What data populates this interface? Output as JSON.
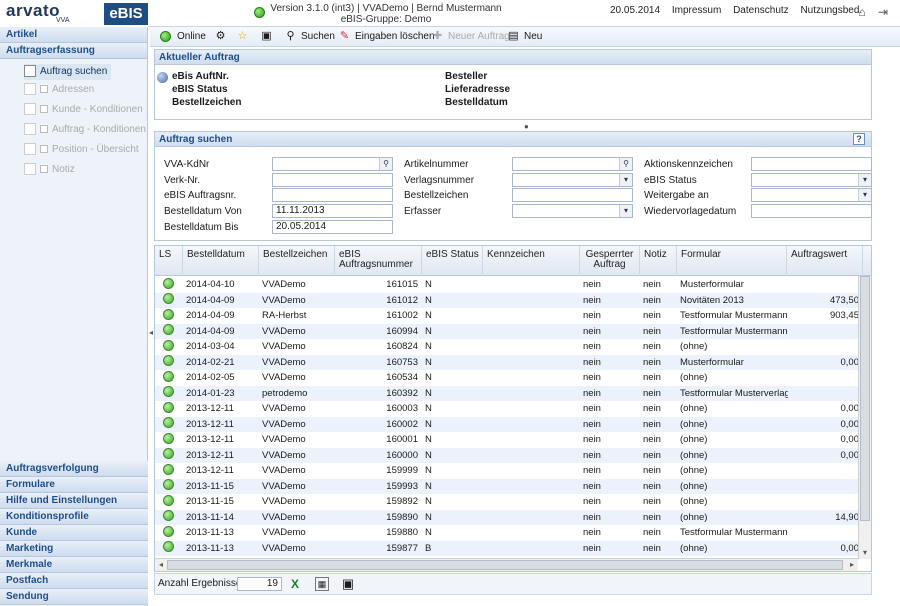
{
  "brand": {
    "logo": "arvato",
    "logo_sub": "VVA",
    "product": "eBIS"
  },
  "header": {
    "line1": "Version 3.1.0 (int3) | VVADemo | Bernd Mustermann",
    "line2": "eBIS-Gruppe: Demo",
    "date": "20.05.2014",
    "links": [
      "Impressum",
      "Datenschutz",
      "Nutzungsbed."
    ]
  },
  "sidebar": {
    "top_sections": [
      "Artikel",
      "Auftragserfassung"
    ],
    "items": [
      {
        "label": "Auftrag suchen",
        "active": true
      },
      {
        "label": "Adressen",
        "active": false
      },
      {
        "label": "Kunde - Konditionen",
        "active": false
      },
      {
        "label": "Auftrag - Konditionen",
        "active": false
      },
      {
        "label": "Position - Übersicht",
        "active": false
      },
      {
        "label": "Notiz",
        "active": false
      }
    ],
    "bottom_sections": [
      "Auftragsverfolgung",
      "Formulare",
      "Hilfe und Einstellungen",
      "Konditionsprofile",
      "Kunde",
      "Marketing",
      "Merkmale",
      "Postfach",
      "Sendung"
    ]
  },
  "toolbar": {
    "online": "Online",
    "search": "Suchen",
    "clear": "Eingaben löschen",
    "new_order": "Neuer Auftrag",
    "new": "Neu"
  },
  "current_order": {
    "title": "Aktueller Auftrag",
    "left": [
      "eBis AuftNr.",
      "eBIS Status",
      "Bestellzeichen"
    ],
    "right": [
      "Besteller",
      "Lieferadresse",
      "Bestelldatum"
    ]
  },
  "search": {
    "title": "Auftrag suchen",
    "help": "?",
    "col1": [
      {
        "label": "VVA-KdNr",
        "value": ""
      },
      {
        "label": "Verk-Nr.",
        "value": ""
      },
      {
        "label": "eBIS Auftragsnr.",
        "value": ""
      },
      {
        "label": "Bestelldatum Von",
        "value": "11.11.2013"
      },
      {
        "label": "Bestelldatum Bis",
        "value": "20.05.2014"
      }
    ],
    "col2": [
      {
        "label": "Artikelnummer",
        "value": ""
      },
      {
        "label": "Verlagsnummer",
        "value": ""
      },
      {
        "label": "Bestellzeichen",
        "value": ""
      },
      {
        "label": "Erfasser",
        "value": ""
      }
    ],
    "col3": [
      {
        "label": "Aktionskennzeichen",
        "value": ""
      },
      {
        "label": "eBIS Status",
        "value": ""
      },
      {
        "label": "Weitergabe an",
        "value": ""
      },
      {
        "label": "Wiedervorlagedatum",
        "value": ""
      }
    ]
  },
  "table": {
    "headers": [
      "LS",
      "Bestelldatum",
      "Bestellzeichen",
      "eBIS Auftragsnummer",
      "eBIS Status",
      "Kennzeichen",
      "Gesperrter Auftrag",
      "Notiz",
      "Formular",
      "Auftragswert"
    ],
    "rows": [
      [
        "2014-04-10",
        "VVADemo",
        "161015",
        "N",
        "nein",
        "nein",
        "Musterformular",
        ""
      ],
      [
        "2014-04-09",
        "VVADemo",
        "161012",
        "N",
        "nein",
        "nein",
        "Novitäten 2013",
        "473,50"
      ],
      [
        "2014-04-09",
        "RA-Herbst",
        "161002",
        "N",
        "nein",
        "nein",
        "Testformular Mustermann",
        "903,45"
      ],
      [
        "2014-04-09",
        "VVADemo",
        "160994",
        "N",
        "nein",
        "nein",
        "Testformular Mustermann",
        ""
      ],
      [
        "2014-03-04",
        "VVADemo",
        "160824",
        "N",
        "nein",
        "nein",
        "(ohne)",
        ""
      ],
      [
        "2014-02-21",
        "VVADemo",
        "160753",
        "N",
        "nein",
        "nein",
        "Musterformular",
        "0,00"
      ],
      [
        "2014-02-05",
        "VVADemo",
        "160534",
        "N",
        "nein",
        "nein",
        "(ohne)",
        ""
      ],
      [
        "2014-01-23",
        "petrodemo",
        "160392",
        "N",
        "nein",
        "nein",
        "Testformular Musterverlag",
        ""
      ],
      [
        "2013-12-11",
        "VVADemo",
        "160003",
        "N",
        "nein",
        "nein",
        "(ohne)",
        "0,00"
      ],
      [
        "2013-12-11",
        "VVADemo",
        "160002",
        "N",
        "nein",
        "nein",
        "(ohne)",
        "0,00"
      ],
      [
        "2013-12-11",
        "VVADemo",
        "160001",
        "N",
        "nein",
        "nein",
        "(ohne)",
        "0,00"
      ],
      [
        "2013-12-11",
        "VVADemo",
        "160000",
        "N",
        "nein",
        "nein",
        "(ohne)",
        "0,00"
      ],
      [
        "2013-12-11",
        "VVADemo",
        "159999",
        "N",
        "nein",
        "nein",
        "(ohne)",
        ""
      ],
      [
        "2013-11-15",
        "VVADemo",
        "159993",
        "N",
        "nein",
        "nein",
        "(ohne)",
        ""
      ],
      [
        "2013-11-15",
        "VVADemo",
        "159892",
        "N",
        "nein",
        "nein",
        "(ohne)",
        ""
      ],
      [
        "2013-11-14",
        "VVADemo",
        "159890",
        "N",
        "nein",
        "nein",
        "(ohne)",
        "14,90"
      ],
      [
        "2013-11-13",
        "VVADemo",
        "159880",
        "N",
        "nein",
        "nein",
        "Testformular Mustermann",
        ""
      ],
      [
        "2013-11-13",
        "VVADemo",
        "159877",
        "B",
        "nein",
        "nein",
        "(ohne)",
        "0,00"
      ]
    ]
  },
  "footer": {
    "count_label": "Anzahl Ergebnisse:",
    "count": "19"
  },
  "colors": {
    "accent": "#1e4f8a",
    "status_green": "#3aa427",
    "row_alt": "#ebf2fb"
  }
}
